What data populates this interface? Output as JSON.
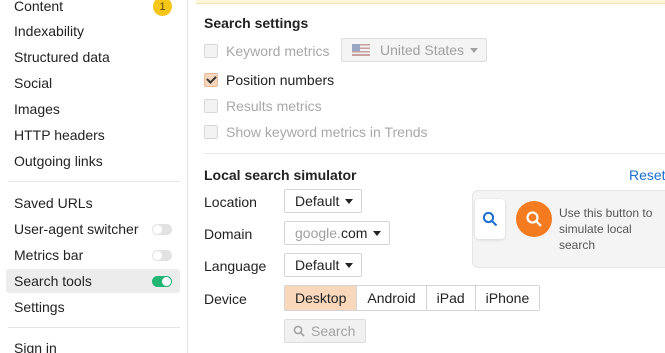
{
  "sidebar": {
    "items": [
      {
        "label": "Content",
        "badge": "1"
      },
      {
        "label": "Indexability"
      },
      {
        "label": "Structured data"
      },
      {
        "label": "Social"
      },
      {
        "label": "Images"
      },
      {
        "label": "HTTP headers"
      },
      {
        "label": "Outgoing links"
      }
    ],
    "tools": [
      {
        "label": "Saved URLs"
      },
      {
        "label": "User-agent switcher",
        "toggle": "off"
      },
      {
        "label": "Metrics bar",
        "toggle": "off"
      },
      {
        "label": "Search tools",
        "toggle": "on",
        "active": true
      },
      {
        "label": "Settings"
      }
    ],
    "footer": {
      "label": "Sign in"
    }
  },
  "search_settings": {
    "title": "Search settings",
    "keyword_metrics": {
      "label": "Keyword metrics",
      "checked": false,
      "disabled": true
    },
    "country": {
      "value": "United States",
      "icon": "us-flag-icon"
    },
    "position_numbers": {
      "label": "Position numbers",
      "checked": true
    },
    "results_metrics": {
      "label": "Results metrics",
      "checked": false,
      "disabled": true
    },
    "trends_metrics": {
      "label": "Show keyword metrics in Trends",
      "checked": false,
      "disabled": true
    }
  },
  "simulator": {
    "title": "Local search simulator",
    "reset_label": "Reset",
    "location": {
      "label": "Location",
      "value": "Default"
    },
    "domain": {
      "label": "Domain",
      "prefix": "google.",
      "value": "com"
    },
    "language": {
      "label": "Language",
      "value": "Default"
    },
    "device": {
      "label": "Device",
      "options": [
        "Desktop",
        "Android",
        "iPad",
        "iPhone"
      ],
      "selected": "Desktop"
    },
    "search_button": "Search",
    "hint": "Use this button to simulate local search"
  },
  "colors": {
    "accent": "#f47b20",
    "toggle_on": "#22b573",
    "badge": "#f5c518",
    "link": "#1a6fcf"
  }
}
